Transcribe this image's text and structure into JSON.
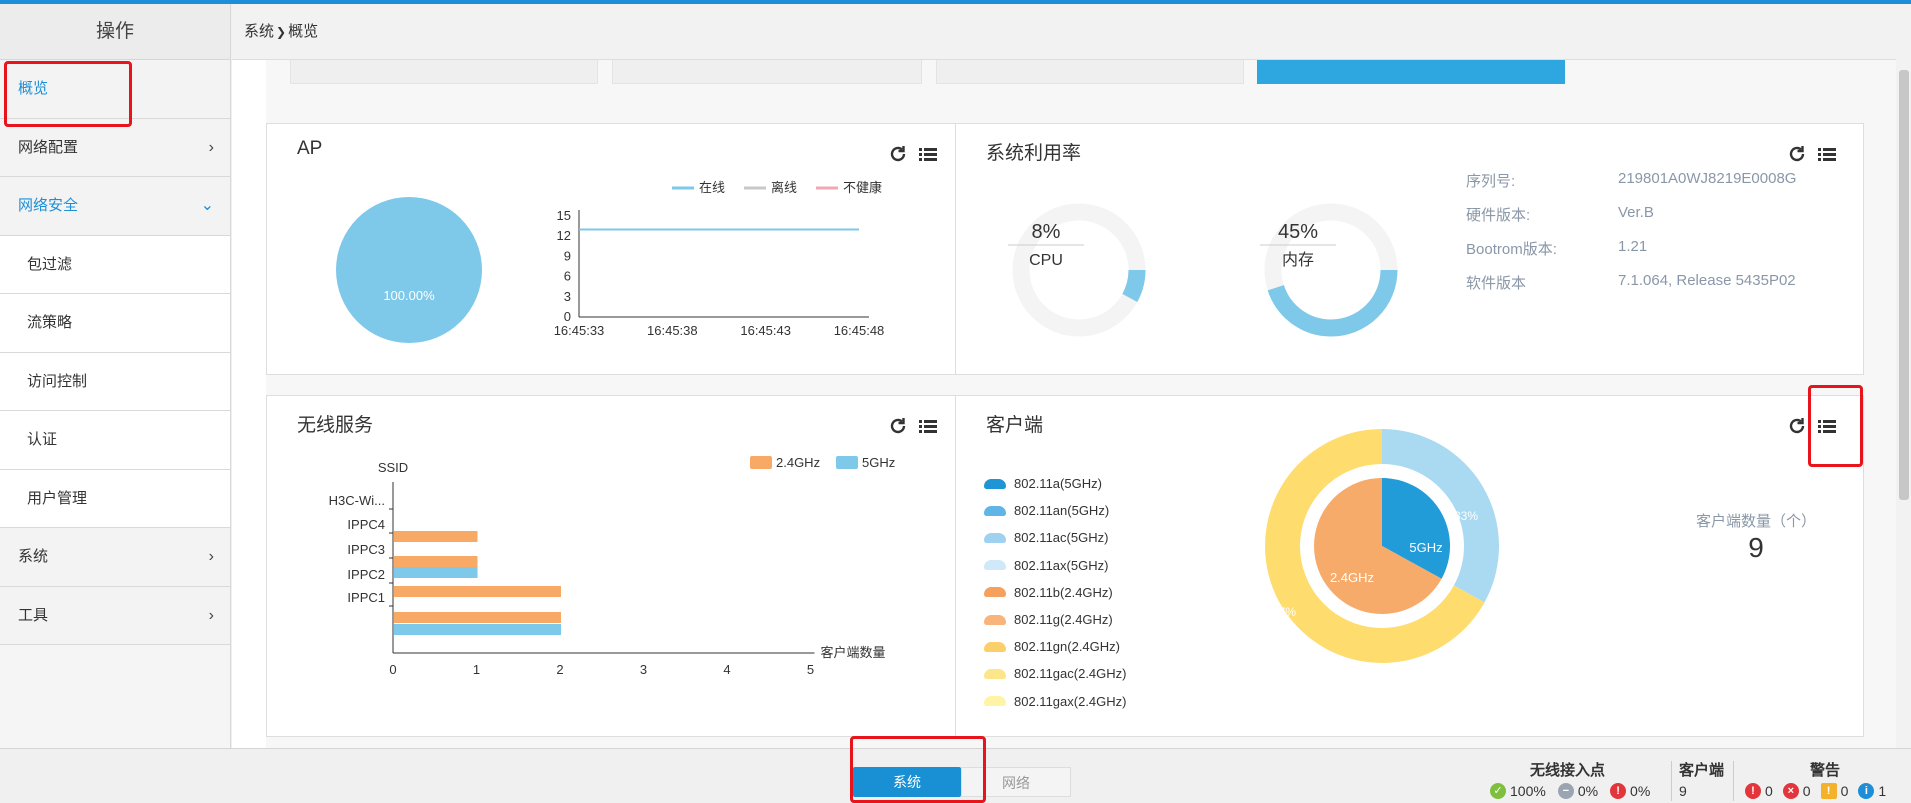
{
  "sidebar": {
    "header": "操作",
    "items": [
      {
        "label": "概览",
        "active": true,
        "chevron": ""
      },
      {
        "label": "网络配置",
        "chevron": "›"
      },
      {
        "label": "网络安全",
        "active": true,
        "chevron": "⌄"
      },
      {
        "label": "包过滤",
        "sub": true
      },
      {
        "label": "流策略",
        "sub": true
      },
      {
        "label": "访问控制",
        "sub": true
      },
      {
        "label": "认证",
        "sub": true
      },
      {
        "label": "用户管理",
        "sub": true
      },
      {
        "label": "系统",
        "chevron": "›"
      },
      {
        "label": "工具",
        "chevron": "›"
      }
    ]
  },
  "breadcrumb": {
    "root": "系统",
    "sep": "❯",
    "current": "概览"
  },
  "ap_card": {
    "title": "AP",
    "pie_label": "100.00%",
    "legend": [
      "在线",
      "离线",
      "不健康"
    ]
  },
  "sysuse_card": {
    "title": "系统利用率",
    "cpu": {
      "value": "8%",
      "label": "CPU",
      "fraction": 0.08
    },
    "mem": {
      "value": "45%",
      "label": "内存",
      "fraction": 0.45
    },
    "info": [
      {
        "key": "序列号:",
        "val": "219801A0WJ8219E0008G"
      },
      {
        "key": "硬件版本:",
        "val": "Ver.B"
      },
      {
        "key": "Bootrom版本:",
        "val": "1.21"
      },
      {
        "key": "软件版本",
        "val": "7.1.064, Release 5435P02"
      }
    ]
  },
  "wireless_card": {
    "title": "无线服务"
  },
  "client_card": {
    "title": "客户端",
    "legend": [
      {
        "label": "802.11a(5GHz)",
        "color": "#1e96d6"
      },
      {
        "label": "802.11an(5GHz)",
        "color": "#5fb5e5"
      },
      {
        "label": "802.11ac(5GHz)",
        "color": "#9fd2f0"
      },
      {
        "label": "802.11ax(5GHz)",
        "color": "#cfe9f8"
      },
      {
        "label": "802.11b(2.4GHz)",
        "color": "#f6a05d"
      },
      {
        "label": "802.11g(2.4GHz)",
        "color": "#f8b47a"
      },
      {
        "label": "802.11gn(2.4GHz)",
        "color": "#fbd06a"
      },
      {
        "label": "802.11gac(2.4GHz)",
        "color": "#fde58a"
      },
      {
        "label": "802.11gax(2.4GHz)",
        "color": "#fff3a6"
      }
    ],
    "count_label": "客户端数量（个）",
    "count": "9"
  },
  "chart_data": [
    {
      "type": "pie",
      "labels": [
        ""
      ],
      "values": [
        100
      ],
      "value_labels": [
        "100.00%"
      ]
    },
    {
      "type": "line",
      "x": [
        "16:45:33",
        "16:45:38",
        "16:45:43",
        "16:45:48"
      ],
      "series": [
        {
          "name": "在线",
          "values": [
            13,
            13,
            13,
            13
          ],
          "color": "#7ec8ea"
        },
        {
          "name": "离线",
          "values": [],
          "color": "#c8c8c8"
        },
        {
          "name": "不健康",
          "values": [],
          "color": "#f1a7b4"
        }
      ],
      "ylim": [
        0,
        15
      ],
      "yticks": [
        0,
        3,
        6,
        9,
        12,
        15
      ],
      "legend": "top-right"
    },
    {
      "type": "bar",
      "orientation": "horizontal",
      "ylabel": "SSID",
      "xlabel": "客户端数量",
      "categories": [
        "H3C-Wi...",
        "IPPC4",
        "IPPC3",
        "IPPC2",
        "IPPC1"
      ],
      "series": [
        {
          "name": "2.4GHz",
          "values": [
            0,
            1,
            1,
            2,
            2
          ],
          "color": "#f7a965"
        },
        {
          "name": "5GHz",
          "values": [
            0,
            0,
            1,
            0,
            2
          ],
          "color": "#7ec8ea"
        }
      ],
      "xlim": [
        0,
        5
      ],
      "xticks": [
        0,
        1,
        2,
        3,
        4,
        5
      ],
      "legend": "top-right"
    },
    {
      "type": "pie",
      "inner": {
        "labels": [
          "5GHz",
          "2.4GHz"
        ],
        "values": [
          33,
          67
        ],
        "colors": [
          "#229bd9",
          "#f7ab6b"
        ]
      },
      "outer": {
        "values": [
          33,
          67
        ],
        "value_labels": [
          "33%",
          "67%"
        ],
        "colors": [
          "#a9daf1",
          "#fedc6e"
        ]
      }
    }
  ],
  "statusbar": {
    "btn_system": "系统",
    "btn_network": "网络",
    "ap_title": "无线接入点",
    "ap_ok": "100%",
    "ap_minus": "0%",
    "ap_err": "0%",
    "client_title": "客户端",
    "client_val": "9",
    "alarm_title": "警告",
    "alarm_a": "0",
    "alarm_b": "0",
    "alarm_c": "0",
    "alarm_d": "1"
  }
}
